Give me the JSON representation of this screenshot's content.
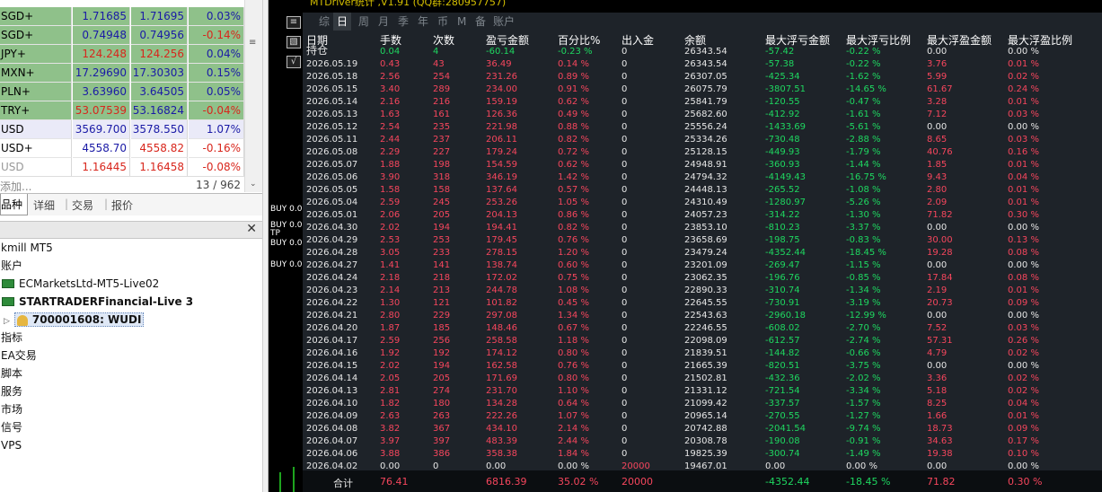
{
  "market_watch": {
    "rows": [
      {
        "sym": "SGD+",
        "bid": "1.71685",
        "ask": "1.71695",
        "chg": "0.03%",
        "chg_color": "#1a1aa6",
        "style": "g"
      },
      {
        "sym": "SGD+",
        "bid": "0.74948",
        "ask": "0.74956",
        "chg": "-0.14%",
        "chg_color": "#d8261c",
        "style": "g"
      },
      {
        "sym": "JPY+",
        "bid": "124.248",
        "ask": "124.256",
        "chg": "0.04%",
        "chg_color": "#1a1aa6",
        "style": "g",
        "bid_color": "#d8261c",
        "ask_color": "#d8261c"
      },
      {
        "sym": "MXN+",
        "bid": "17.29690",
        "ask": "17.30303",
        "chg": "0.15%",
        "chg_color": "#1a1aa6",
        "style": "g"
      },
      {
        "sym": "PLN+",
        "bid": "3.63960",
        "ask": "3.64505",
        "chg": "0.05%",
        "chg_color": "#1a1aa6",
        "style": "g"
      },
      {
        "sym": "TRY+",
        "bid": "53.07539",
        "ask": "53.16824",
        "chg": "-0.04%",
        "chg_color": "#d8261c",
        "style": "g",
        "bid_color": "#d8261c"
      },
      {
        "sym": "USD",
        "bid": "3569.700",
        "ask": "3578.550",
        "chg": "1.07%",
        "chg_color": "#1a1aa6",
        "style": "p"
      },
      {
        "sym": "USD+",
        "bid": "4558.70",
        "ask": "4558.82",
        "chg": "-0.16%",
        "chg_color": "#d8261c",
        "style": "w",
        "ask_color": "#d8261c"
      },
      {
        "sym": "USD",
        "bid": "1.16445",
        "ask": "1.16458",
        "chg": "-0.08%",
        "chg_color": "#d8261c",
        "style": "w",
        "sym_color": "#999999",
        "bid_color": "#d8261c",
        "ask_color": "#d8261c"
      }
    ],
    "add_label": "添加...",
    "count": "13 / 962",
    "tabs": [
      "品种",
      "详细",
      "交易",
      "报价"
    ]
  },
  "navigator": {
    "broker": "kmill MT5",
    "accounts": "账户",
    "server1": "ECMarketsLtd-MT5-Live02",
    "server2": "STARTRADERFinancial-Live 3",
    "account": "700001608: WUDI",
    "items": [
      "指标",
      "EA交易",
      "脚本",
      "服务",
      "市场",
      "信号",
      "VPS"
    ]
  },
  "chart": {
    "title": "MTDriver统计 ,V1.91 (QQ群:280957757)",
    "buy_labels": [
      "BUY 0.0",
      "BUY 0.0",
      "TP",
      "BUY 0.0",
      "BUY 0.0"
    ]
  },
  "stats": {
    "tabs": [
      "综",
      "日",
      "周",
      "月",
      "季",
      "年",
      "币",
      "M",
      "备",
      "账户"
    ],
    "active_tab": 1,
    "headers": [
      "日期",
      "手数",
      "次数",
      "盈亏金额",
      "百分比%",
      "出入金",
      "余额",
      "最大浮亏金额",
      "最大浮亏比例",
      "最大浮盈金额",
      "最大浮盈比例"
    ],
    "hold": {
      "label": "持仓",
      "lots": "0.04",
      "count": "4",
      "pnl": "-60.14",
      "pct": "-0.23 %",
      "io": "0",
      "bal": "26343.54",
      "fl": "-57.42",
      "flp": "-0.22 %",
      "fp": "0.00",
      "fpp": "0.00 %"
    },
    "rows": [
      [
        "2026.05.19",
        "0.43",
        "43",
        "36.49",
        "0.14 %",
        "0",
        "26343.54",
        "-57.38",
        "-0.22 %",
        "3.76",
        "0.01 %"
      ],
      [
        "2026.05.18",
        "2.56",
        "254",
        "231.26",
        "0.89 %",
        "0",
        "26307.05",
        "-425.34",
        "-1.62 %",
        "5.99",
        "0.02 %"
      ],
      [
        "2026.05.15",
        "3.40",
        "289",
        "234.00",
        "0.91 %",
        "0",
        "26075.79",
        "-3807.51",
        "-14.65 %",
        "61.67",
        "0.24 %"
      ],
      [
        "2026.05.14",
        "2.16",
        "216",
        "159.19",
        "0.62 %",
        "0",
        "25841.79",
        "-120.55",
        "-0.47 %",
        "3.28",
        "0.01 %"
      ],
      [
        "2026.05.13",
        "1.63",
        "161",
        "126.36",
        "0.49 %",
        "0",
        "25682.60",
        "-412.92",
        "-1.61 %",
        "7.12",
        "0.03 %"
      ],
      [
        "2026.05.12",
        "2.54",
        "235",
        "221.98",
        "0.88 %",
        "0",
        "25556.24",
        "-1433.69",
        "-5.61 %",
        "0.00",
        "0.00 %"
      ],
      [
        "2026.05.11",
        "2.44",
        "237",
        "206.11",
        "0.82 %",
        "0",
        "25334.26",
        "-730.48",
        "-2.88 %",
        "8.65",
        "0.03 %"
      ],
      [
        "2026.05.08",
        "2.29",
        "227",
        "179.24",
        "0.72 %",
        "0",
        "25128.15",
        "-449.93",
        "-1.79 %",
        "40.76",
        "0.16 %"
      ],
      [
        "2026.05.07",
        "1.88",
        "198",
        "154.59",
        "0.62 %",
        "0",
        "24948.91",
        "-360.93",
        "-1.44 %",
        "1.85",
        "0.01 %"
      ],
      [
        "2026.05.06",
        "3.90",
        "318",
        "346.19",
        "1.42 %",
        "0",
        "24794.32",
        "-4149.43",
        "-16.75 %",
        "9.43",
        "0.04 %"
      ],
      [
        "2026.05.05",
        "1.58",
        "158",
        "137.64",
        "0.57 %",
        "0",
        "24448.13",
        "-265.52",
        "-1.08 %",
        "2.80",
        "0.01 %"
      ],
      [
        "2026.05.04",
        "2.59",
        "245",
        "253.26",
        "1.05 %",
        "0",
        "24310.49",
        "-1280.97",
        "-5.26 %",
        "2.09",
        "0.01 %"
      ],
      [
        "2026.05.01",
        "2.06",
        "205",
        "204.13",
        "0.86 %",
        "0",
        "24057.23",
        "-314.22",
        "-1.30 %",
        "71.82",
        "0.30 %"
      ],
      [
        "2026.04.30",
        "2.02",
        "194",
        "194.41",
        "0.82 %",
        "0",
        "23853.10",
        "-810.23",
        "-3.37 %",
        "0.00",
        "0.00 %"
      ],
      [
        "2026.04.29",
        "2.53",
        "253",
        "179.45",
        "0.76 %",
        "0",
        "23658.69",
        "-198.75",
        "-0.83 %",
        "30.00",
        "0.13 %"
      ],
      [
        "2026.04.28",
        "3.05",
        "233",
        "278.15",
        "1.20 %",
        "0",
        "23479.24",
        "-4352.44",
        "-18.45 %",
        "19.28",
        "0.08 %"
      ],
      [
        "2026.04.27",
        "1.41",
        "141",
        "138.74",
        "0.60 %",
        "0",
        "23201.09",
        "-269.47",
        "-1.15 %",
        "0.00",
        "0.00 %"
      ],
      [
        "2026.04.24",
        "2.18",
        "218",
        "172.02",
        "0.75 %",
        "0",
        "23062.35",
        "-196.76",
        "-0.85 %",
        "17.84",
        "0.08 %"
      ],
      [
        "2026.04.23",
        "2.14",
        "213",
        "244.78",
        "1.08 %",
        "0",
        "22890.33",
        "-310.74",
        "-1.34 %",
        "2.19",
        "0.01 %"
      ],
      [
        "2026.04.22",
        "1.30",
        "121",
        "101.82",
        "0.45 %",
        "0",
        "22645.55",
        "-730.91",
        "-3.19 %",
        "20.73",
        "0.09 %"
      ],
      [
        "2026.04.21",
        "2.80",
        "229",
        "297.08",
        "1.34 %",
        "0",
        "22543.63",
        "-2960.18",
        "-12.99 %",
        "0.00",
        "0.00 %"
      ],
      [
        "2026.04.20",
        "1.87",
        "185",
        "148.46",
        "0.67 %",
        "0",
        "22246.55",
        "-608.02",
        "-2.70 %",
        "7.52",
        "0.03 %"
      ],
      [
        "2026.04.17",
        "2.59",
        "256",
        "258.58",
        "1.18 %",
        "0",
        "22098.09",
        "-612.57",
        "-2.74 %",
        "57.31",
        "0.26 %"
      ],
      [
        "2026.04.16",
        "1.92",
        "192",
        "174.12",
        "0.80 %",
        "0",
        "21839.51",
        "-144.82",
        "-0.66 %",
        "4.79",
        "0.02 %"
      ],
      [
        "2026.04.15",
        "2.02",
        "194",
        "162.58",
        "0.76 %",
        "0",
        "21665.39",
        "-820.51",
        "-3.75 %",
        "0.00",
        "0.00 %"
      ],
      [
        "2026.04.14",
        "2.05",
        "205",
        "171.69",
        "0.80 %",
        "0",
        "21502.81",
        "-432.36",
        "-2.02 %",
        "3.36",
        "0.02 %"
      ],
      [
        "2026.04.13",
        "2.81",
        "274",
        "231.70",
        "1.10 %",
        "0",
        "21331.12",
        "-721.54",
        "-3.34 %",
        "5.18",
        "0.02 %"
      ],
      [
        "2026.04.10",
        "1.82",
        "180",
        "134.28",
        "0.64 %",
        "0",
        "21099.42",
        "-337.57",
        "-1.57 %",
        "8.25",
        "0.04 %"
      ],
      [
        "2026.04.09",
        "2.63",
        "263",
        "222.26",
        "1.07 %",
        "0",
        "20965.14",
        "-270.55",
        "-1.27 %",
        "1.66",
        "0.01 %"
      ],
      [
        "2026.04.08",
        "3.82",
        "367",
        "434.10",
        "2.14 %",
        "0",
        "20742.88",
        "-2041.54",
        "-9.74 %",
        "18.73",
        "0.09 %"
      ],
      [
        "2026.04.07",
        "3.97",
        "397",
        "483.39",
        "2.44 %",
        "0",
        "20308.78",
        "-190.08",
        "-0.91 %",
        "34.63",
        "0.17 %"
      ],
      [
        "2026.04.06",
        "3.88",
        "386",
        "358.38",
        "1.84 %",
        "0",
        "19825.39",
        "-300.74",
        "-1.49 %",
        "19.38",
        "0.10 %"
      ],
      [
        "2026.04.02",
        "0.00",
        "0",
        "0.00",
        "0.00 %",
        "20000",
        "19467.01",
        "0.00",
        "0.00 %",
        "0.00",
        "0.00 %"
      ]
    ],
    "footer": {
      "label": "合计",
      "lots": "76.41",
      "pnl": "6816.39",
      "pct": "35.02 %",
      "io": "20000",
      "fl": "-4352.44",
      "flp": "-18.45 %",
      "fp": "71.82",
      "fpp": "0.30 %"
    }
  }
}
